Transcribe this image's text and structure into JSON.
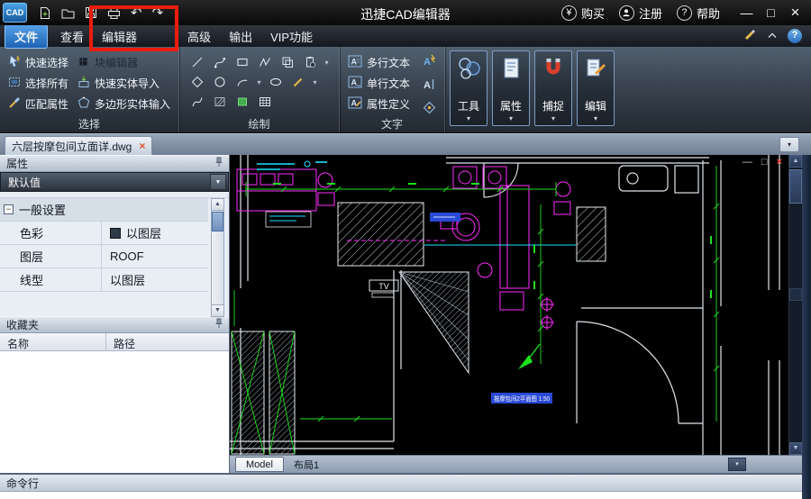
{
  "titlebar": {
    "logo": "CAD",
    "title": "迅捷CAD编辑器",
    "buy": "购买",
    "register": "注册",
    "help": "帮助"
  },
  "menu": {
    "tabs": [
      "文件",
      "查看",
      "编辑器",
      "高级",
      "输出",
      "VIP功能"
    ]
  },
  "ribbon": {
    "selection": {
      "label": "选择",
      "items": [
        "快速选择",
        "选择所有",
        "匹配属性",
        "块编辑器",
        "快速实体导入",
        "多边形实体输入"
      ]
    },
    "draw": {
      "label": "绘制"
    },
    "text": {
      "label": "文字",
      "items": [
        "多行文本",
        "单行文本",
        "属性定义"
      ]
    },
    "panels": [
      "工具",
      "属性",
      "捕捉",
      "编辑"
    ]
  },
  "doc": {
    "tab": "六层按摩包间立面详.dwg"
  },
  "properties": {
    "title": "属性",
    "preset": "默认值",
    "group": "一般设置",
    "rows": [
      {
        "label": "色彩",
        "value": "以图层"
      },
      {
        "label": "图层",
        "value": "ROOF"
      },
      {
        "label": "线型",
        "value": "以图层"
      }
    ]
  },
  "favorites": {
    "title": "收藏夹",
    "columns": [
      "名称",
      "路径"
    ]
  },
  "canvas": {
    "plan_label": "按摩包间2平面图 1:50",
    "tv_label": "TV"
  },
  "layout": {
    "model": "Model",
    "layout1": "布局1"
  },
  "command": {
    "title": "命令行"
  }
}
